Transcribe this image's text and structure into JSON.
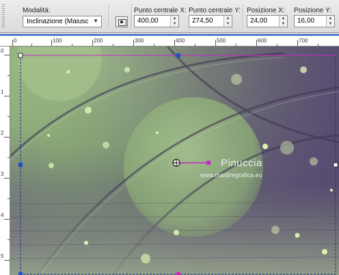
{
  "toolbar": {
    "mode_label": "Modalità:",
    "mode_value": "Inclinazione (Maiusc)",
    "center_x_label": "Punto centrale X:",
    "center_x_value": "400,00",
    "center_y_label": "Punto centrale Y:",
    "center_y_value": "274,50",
    "pos_x_label": "Posizione X:",
    "pos_x_value": "24,00",
    "pos_y_label": "Posizione Y:",
    "pos_y_value": "16,00"
  },
  "ruler": {
    "top_ticks": [
      "0",
      "100",
      "200",
      "300",
      "400",
      "500",
      "600",
      "700"
    ],
    "left_ticks": [
      "0",
      "1",
      "2",
      "3",
      "4",
      "5"
    ]
  },
  "watermark": {
    "name": "Pinuccia",
    "url": "www.maidiregrafica.eu"
  },
  "colors": {
    "green": "#9dbb82",
    "purple": "#6b5680",
    "handle_blue": "#1f4fd0",
    "rotate_magenta": "#cc22cc"
  },
  "icons": [
    "grip-icon",
    "dropdown-arrow-icon",
    "pick-tool-icon",
    "spin-up-icon",
    "spin-down-icon"
  ]
}
